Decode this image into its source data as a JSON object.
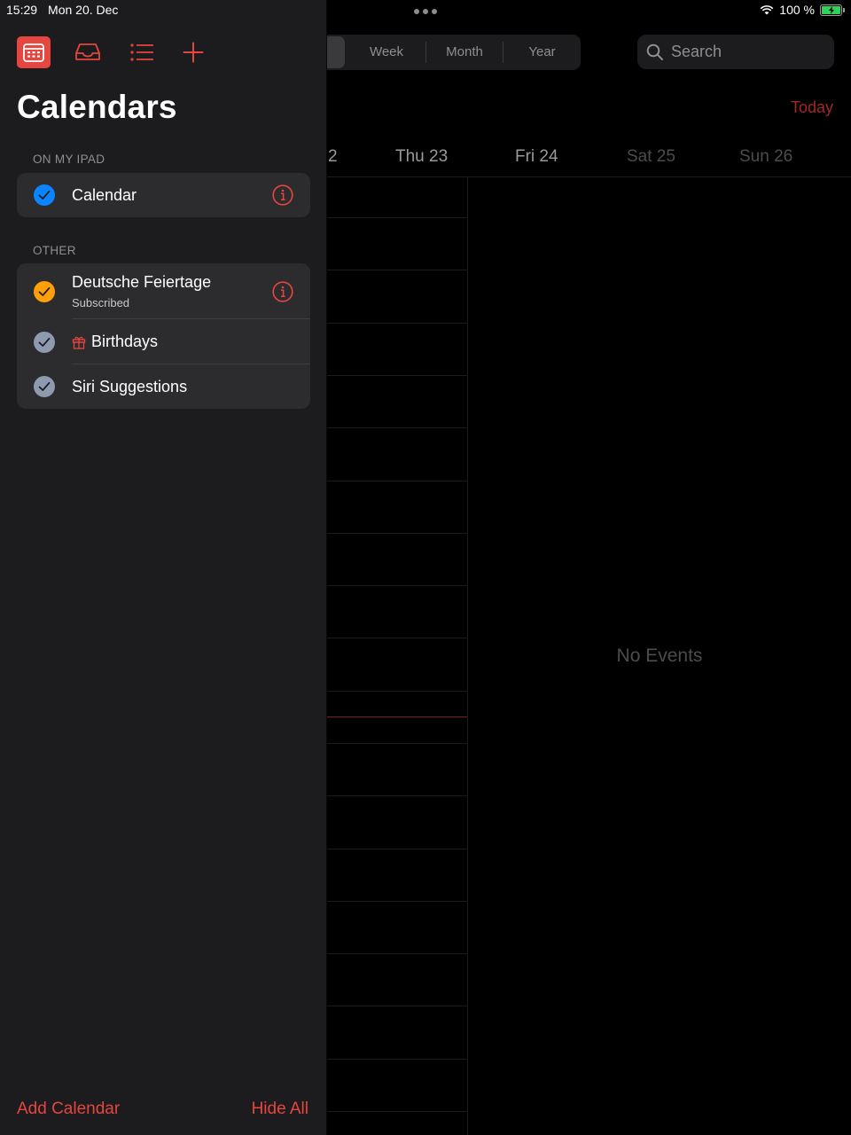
{
  "status_bar": {
    "time": "15:29",
    "date": "Mon 20. Dec",
    "battery": "100 %"
  },
  "main": {
    "view_segments": [
      "Week",
      "Month",
      "Year"
    ],
    "search_placeholder": "Search",
    "today_label": "Today",
    "day_headers": [
      "2",
      "Thu 23",
      "Fri 24",
      "Sat 25",
      "Sun 26"
    ],
    "no_events": "No Events"
  },
  "sidebar": {
    "title": "Calendars",
    "sections": [
      {
        "label": "ON MY IPAD",
        "items": [
          {
            "name": "Calendar",
            "color": "#0a84ff",
            "checked": true,
            "info": true
          }
        ]
      },
      {
        "label": "OTHER",
        "items": [
          {
            "name": "Deutsche Feiertage",
            "subtitle": "Subscribed",
            "color": "#ff9f0a",
            "checked": true,
            "info": true
          },
          {
            "name": "Birthdays",
            "color": "#8e9ab0",
            "checked": true,
            "icon": "gift-icon"
          },
          {
            "name": "Siri Suggestions",
            "color": "#8e9ab0",
            "checked": true
          }
        ]
      }
    ],
    "footer": {
      "add_label": "Add Calendar",
      "hide_label": "Hide All"
    }
  },
  "colors": {
    "accent": "#e5463f",
    "sidebar_bg": "#1c1c1e",
    "group_bg": "#2c2c2e"
  }
}
